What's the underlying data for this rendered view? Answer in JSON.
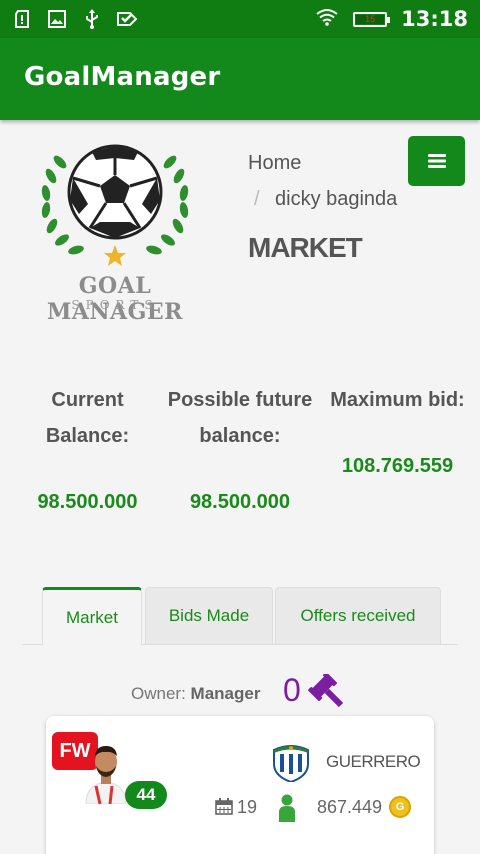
{
  "status_bar": {
    "time": "13:18",
    "battery_level": "15",
    "icons": [
      "sd-card-icon",
      "image-icon",
      "usb-icon",
      "check-icon",
      "wifi-icon",
      "battery-icon"
    ]
  },
  "app_bar": {
    "title": "GoalManager"
  },
  "logo": {
    "line1": "GOAL MANAGER",
    "line2": "SPORTS"
  },
  "breadcrumb": {
    "home": "Home",
    "separator": "/",
    "current": "dicky baginda"
  },
  "page_title": "MARKET",
  "balances": {
    "current": {
      "label": "Current Balance:",
      "value": "98.500.000"
    },
    "future": {
      "label": "Possible future balance:",
      "value": "98.500.000"
    },
    "max_bid": {
      "label": "Maximum bid:",
      "value": "108.769.559"
    }
  },
  "tabs": [
    {
      "label": "Market",
      "active": true
    },
    {
      "label": "Bids Made",
      "active": false
    },
    {
      "label": "Offers received",
      "active": false
    }
  ],
  "owner": {
    "label": "Owner:",
    "name": "Manager",
    "bid_count": "0"
  },
  "player": {
    "position": "FW",
    "rating": "44",
    "name": "GUERRERO",
    "age": "19",
    "price": "867.449",
    "coin_letter": "G"
  },
  "colors": {
    "primary": "#12891a",
    "status_bar": "#0f7d12",
    "accent_value": "#1a8a1a",
    "gavel": "#7a1fa0",
    "badge": "#e3141f"
  }
}
